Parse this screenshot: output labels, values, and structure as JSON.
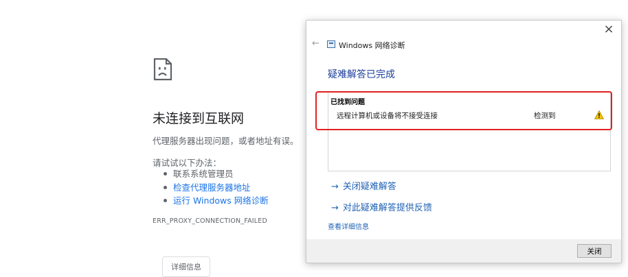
{
  "error_page": {
    "title": "未连接到互联网",
    "subtitle": "代理服务器出现问题，或者地址有误。",
    "try_heading": "请试试以下办法：",
    "suggestions": [
      {
        "label": "联系系统管理员",
        "is_link": false
      },
      {
        "label": "检查代理服务器地址",
        "is_link": true
      },
      {
        "label": "运行 Windows 网络诊断",
        "is_link": true
      }
    ],
    "error_code": "ERR_PROXY_CONNECTION_FAILED",
    "details_button": "详细信息",
    "icon": "sad-page-icon"
  },
  "dialog": {
    "app_title": "Windows 网络诊断",
    "heading": "疑难解答已完成",
    "found_label": "已找到问题",
    "problems": [
      {
        "text": "远程计算机或设备将不接受连接",
        "status": "检测到",
        "icon": "warning-icon"
      }
    ],
    "actions": [
      {
        "label": "关闭疑难解答",
        "icon": "arrow-right-icon"
      },
      {
        "label": "对此疑难解答提供反馈",
        "icon": "arrow-right-icon"
      }
    ],
    "details_link": "查看详细信息",
    "close_button": "关闭",
    "back_glyph": "←",
    "close_glyph": "×",
    "arrow_glyph": "→"
  },
  "colors": {
    "link_blue": "#1a73e8",
    "heading_blue": "#1c3d9b",
    "highlight_red": "#e02020",
    "warning_yellow": "#f5c400"
  }
}
